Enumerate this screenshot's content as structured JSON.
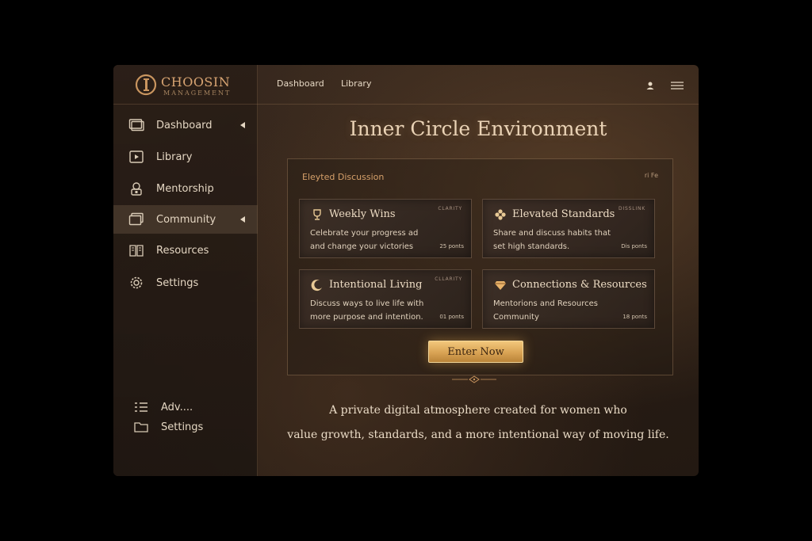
{
  "brand": {
    "name": "CHOOSIN",
    "subtitle": "MANAGEMENT",
    "mark": "CI"
  },
  "sidebar": {
    "items": [
      {
        "label": "Dashboard",
        "icon": "monitor-icon",
        "has_caret": true
      },
      {
        "label": "Library",
        "icon": "play-box-icon",
        "has_caret": false
      },
      {
        "label": "Mentorship",
        "icon": "user-lock-icon",
        "has_caret": false
      },
      {
        "label": "Community",
        "icon": "window-stack-icon",
        "has_caret": true,
        "active": true
      },
      {
        "label": "Resources",
        "icon": "book-open-icon",
        "has_caret": false
      },
      {
        "label": "Settings",
        "icon": "gear-icon",
        "has_caret": false
      }
    ],
    "bottom_items": [
      {
        "label": "Adv....",
        "icon": "list-icon"
      },
      {
        "label": "Settings",
        "icon": "folder-icon"
      }
    ]
  },
  "topbar": {
    "links": [
      "Dashboard",
      "Library"
    ],
    "icons": [
      "user-icon",
      "menu-icon"
    ]
  },
  "main": {
    "title": "Inner Circle Environment",
    "panel": {
      "title": "Eleyted Discussion",
      "meta": "ri Fe",
      "cards": [
        {
          "title": "Weekly Wins",
          "icon": "trophy-icon",
          "tag": "CLARITY",
          "desc_line1": "Celebrate your progress ad",
          "desc_line2": "and change your victories",
          "points": "25 ponts"
        },
        {
          "title": "Elevated Standards",
          "icon": "flower-icon",
          "tag": "DISSLINK",
          "desc_line1": "Share and discuss habits that",
          "desc_line2": "set high standards.",
          "points": "Dis ponts"
        },
        {
          "title": "Intentional Living",
          "icon": "moon-icon",
          "tag": "CLLARITY",
          "desc_line1": "Discuss ways to live life with",
          "desc_line2": "more purpose and intention.",
          "points": "01 ponts"
        },
        {
          "title": "Connections & Resources",
          "icon": "diamond-icon",
          "tag": "",
          "desc_line1": "Mentorions and Resources",
          "desc_line2": "Community",
          "points": "18 ponts"
        }
      ],
      "button_label": "Enter Now"
    },
    "tagline_line1": "A private digital atmosphere created for women who",
    "tagline_line2": "value growth, standards, and a more intentional way of moving life."
  },
  "colors": {
    "accent_gold": "#d9a354",
    "text_cream": "#e6d8c4",
    "bg_dark": "#2a1e16"
  }
}
